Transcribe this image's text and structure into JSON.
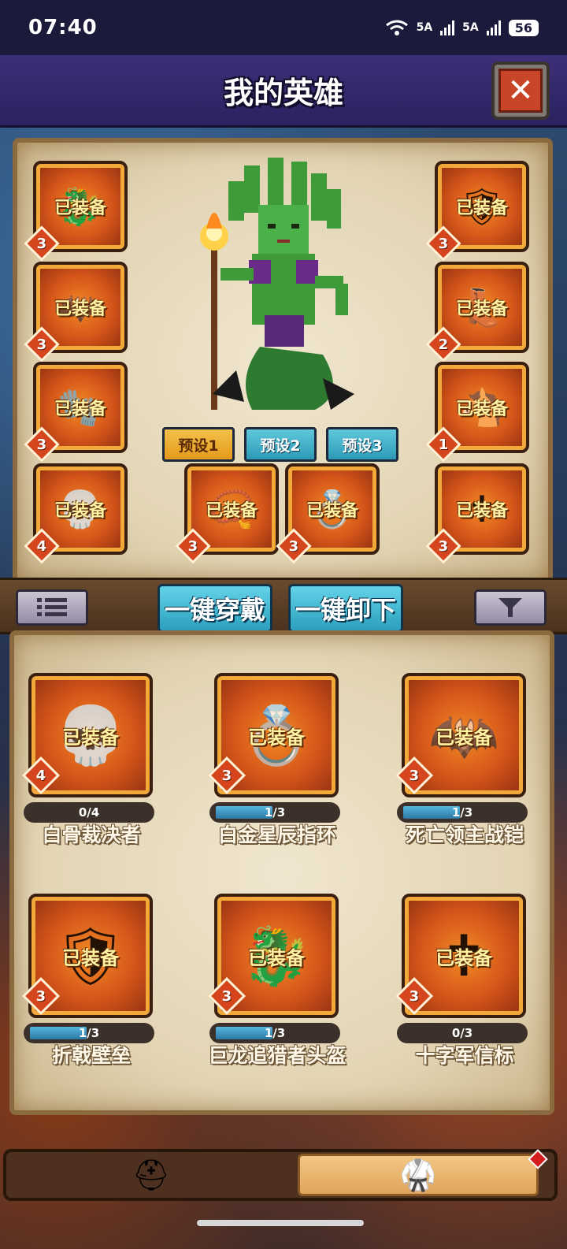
{
  "status_bar": {
    "time": "07:40",
    "signal1_label": "5A",
    "signal2_label": "5A",
    "battery": "56"
  },
  "header": {
    "title": "我的英雄",
    "close_icon": "close-x-icon"
  },
  "equip_panel": {
    "slots": [
      {
        "icon": "dragon-helmet-icon",
        "glyph": "🐉",
        "label": "已装备",
        "level": "3"
      },
      {
        "icon": "shield-icon",
        "glyph": "🛡",
        "label": "已装备",
        "level": "3"
      },
      {
        "icon": "dark-armor-icon",
        "glyph": "🦇",
        "label": "已装备",
        "level": "3"
      },
      {
        "icon": "boots-icon",
        "glyph": "👢",
        "label": "已装备",
        "level": "2"
      },
      {
        "icon": "gauntlet-icon",
        "glyph": "🧤",
        "label": "已装备",
        "level": "3"
      },
      {
        "icon": "mount-icon",
        "glyph": "🐴",
        "label": "已装备",
        "level": "1"
      },
      {
        "icon": "bone-mace-icon",
        "glyph": "💀",
        "label": "已装备",
        "level": "4"
      },
      {
        "icon": "amulet-icon",
        "glyph": "📿",
        "label": "已装备",
        "level": "3"
      },
      {
        "icon": "star-ring-icon",
        "glyph": "💍",
        "label": "已装备",
        "level": "3"
      },
      {
        "icon": "cross-banner-icon",
        "glyph": "✝",
        "label": "已装备",
        "level": "3"
      }
    ],
    "presets": [
      "预设1",
      "预设2",
      "预设3"
    ],
    "active_preset": 0
  },
  "toolbar": {
    "list_icon": "list-icon",
    "equip_all_label": "一键穿戴",
    "unequip_all_label": "一键卸下",
    "filter_icon": "filter-icon"
  },
  "inventory": [
    {
      "name": "白骨裁决者",
      "icon": "bone-mace-icon",
      "glyph": "💀",
      "label": "已装备",
      "level": "4",
      "progress_text": "0/4",
      "progress": 0.0
    },
    {
      "name": "白金星辰指环",
      "icon": "star-ring-icon",
      "glyph": "💍",
      "label": "已装备",
      "level": "3",
      "progress_text": "1/3",
      "progress": 0.333
    },
    {
      "name": "死亡领主战铠",
      "icon": "dark-armor-icon",
      "glyph": "🦇",
      "label": "已装备",
      "level": "3",
      "progress_text": "1/3",
      "progress": 0.333
    },
    {
      "name": "折戟壁垒",
      "icon": "shield-icon",
      "glyph": "🛡",
      "label": "已装备",
      "level": "3",
      "progress_text": "1/3",
      "progress": 0.333
    },
    {
      "name": "巨龙追猎者头盔",
      "icon": "dragon-helmet-icon",
      "glyph": "🐉",
      "label": "已装备",
      "level": "3",
      "progress_text": "1/3",
      "progress": 0.333
    },
    {
      "name": "十字军信标",
      "icon": "cross-banner-icon",
      "glyph": "✝",
      "label": "已装备",
      "level": "3",
      "progress_text": "0/3",
      "progress": 0.0
    }
  ],
  "bottom_nav": {
    "tabs": [
      {
        "icon": "hero-helmet-icon",
        "glyph": "⛑"
      },
      {
        "icon": "armor-icon",
        "glyph": "🥋"
      }
    ],
    "active_tab": 1
  }
}
